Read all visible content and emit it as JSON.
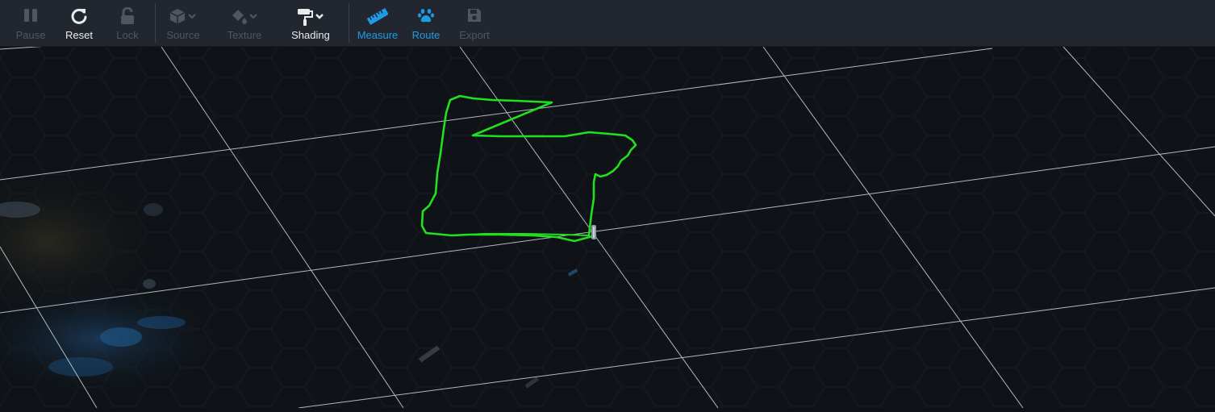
{
  "toolbar": {
    "pause": {
      "label": "Pause",
      "icon": "pause-icon",
      "state": "disabled"
    },
    "reset": {
      "label": "Reset",
      "icon": "reset-icon",
      "state": "normal"
    },
    "lock": {
      "label": "Lock",
      "icon": "lock-icon",
      "state": "disabled"
    },
    "source": {
      "label": "Source",
      "icon": "cube-icon",
      "state": "disabled",
      "has_dropdown": true
    },
    "texture": {
      "label": "Texture",
      "icon": "paint-bucket-icon",
      "state": "disabled",
      "has_dropdown": true
    },
    "shading": {
      "label": "Shading",
      "icon": "paint-roller-icon",
      "state": "normal",
      "has_dropdown": true
    },
    "measure": {
      "label": "Measure",
      "icon": "ruler-icon",
      "state": "active"
    },
    "route": {
      "label": "Route",
      "icon": "paw-icon",
      "state": "active"
    },
    "export": {
      "label": "Export",
      "icon": "save-icon",
      "state": "disabled"
    }
  },
  "colors": {
    "toolbar_bg": "#22272f",
    "viewport_bg": "#0f1317",
    "active_accent": "#1e9be6",
    "disabled_text": "#4e5661",
    "normal_text": "#e8ecef",
    "route_path": "#22e01f",
    "grid_lines": "#cfd6dc"
  }
}
